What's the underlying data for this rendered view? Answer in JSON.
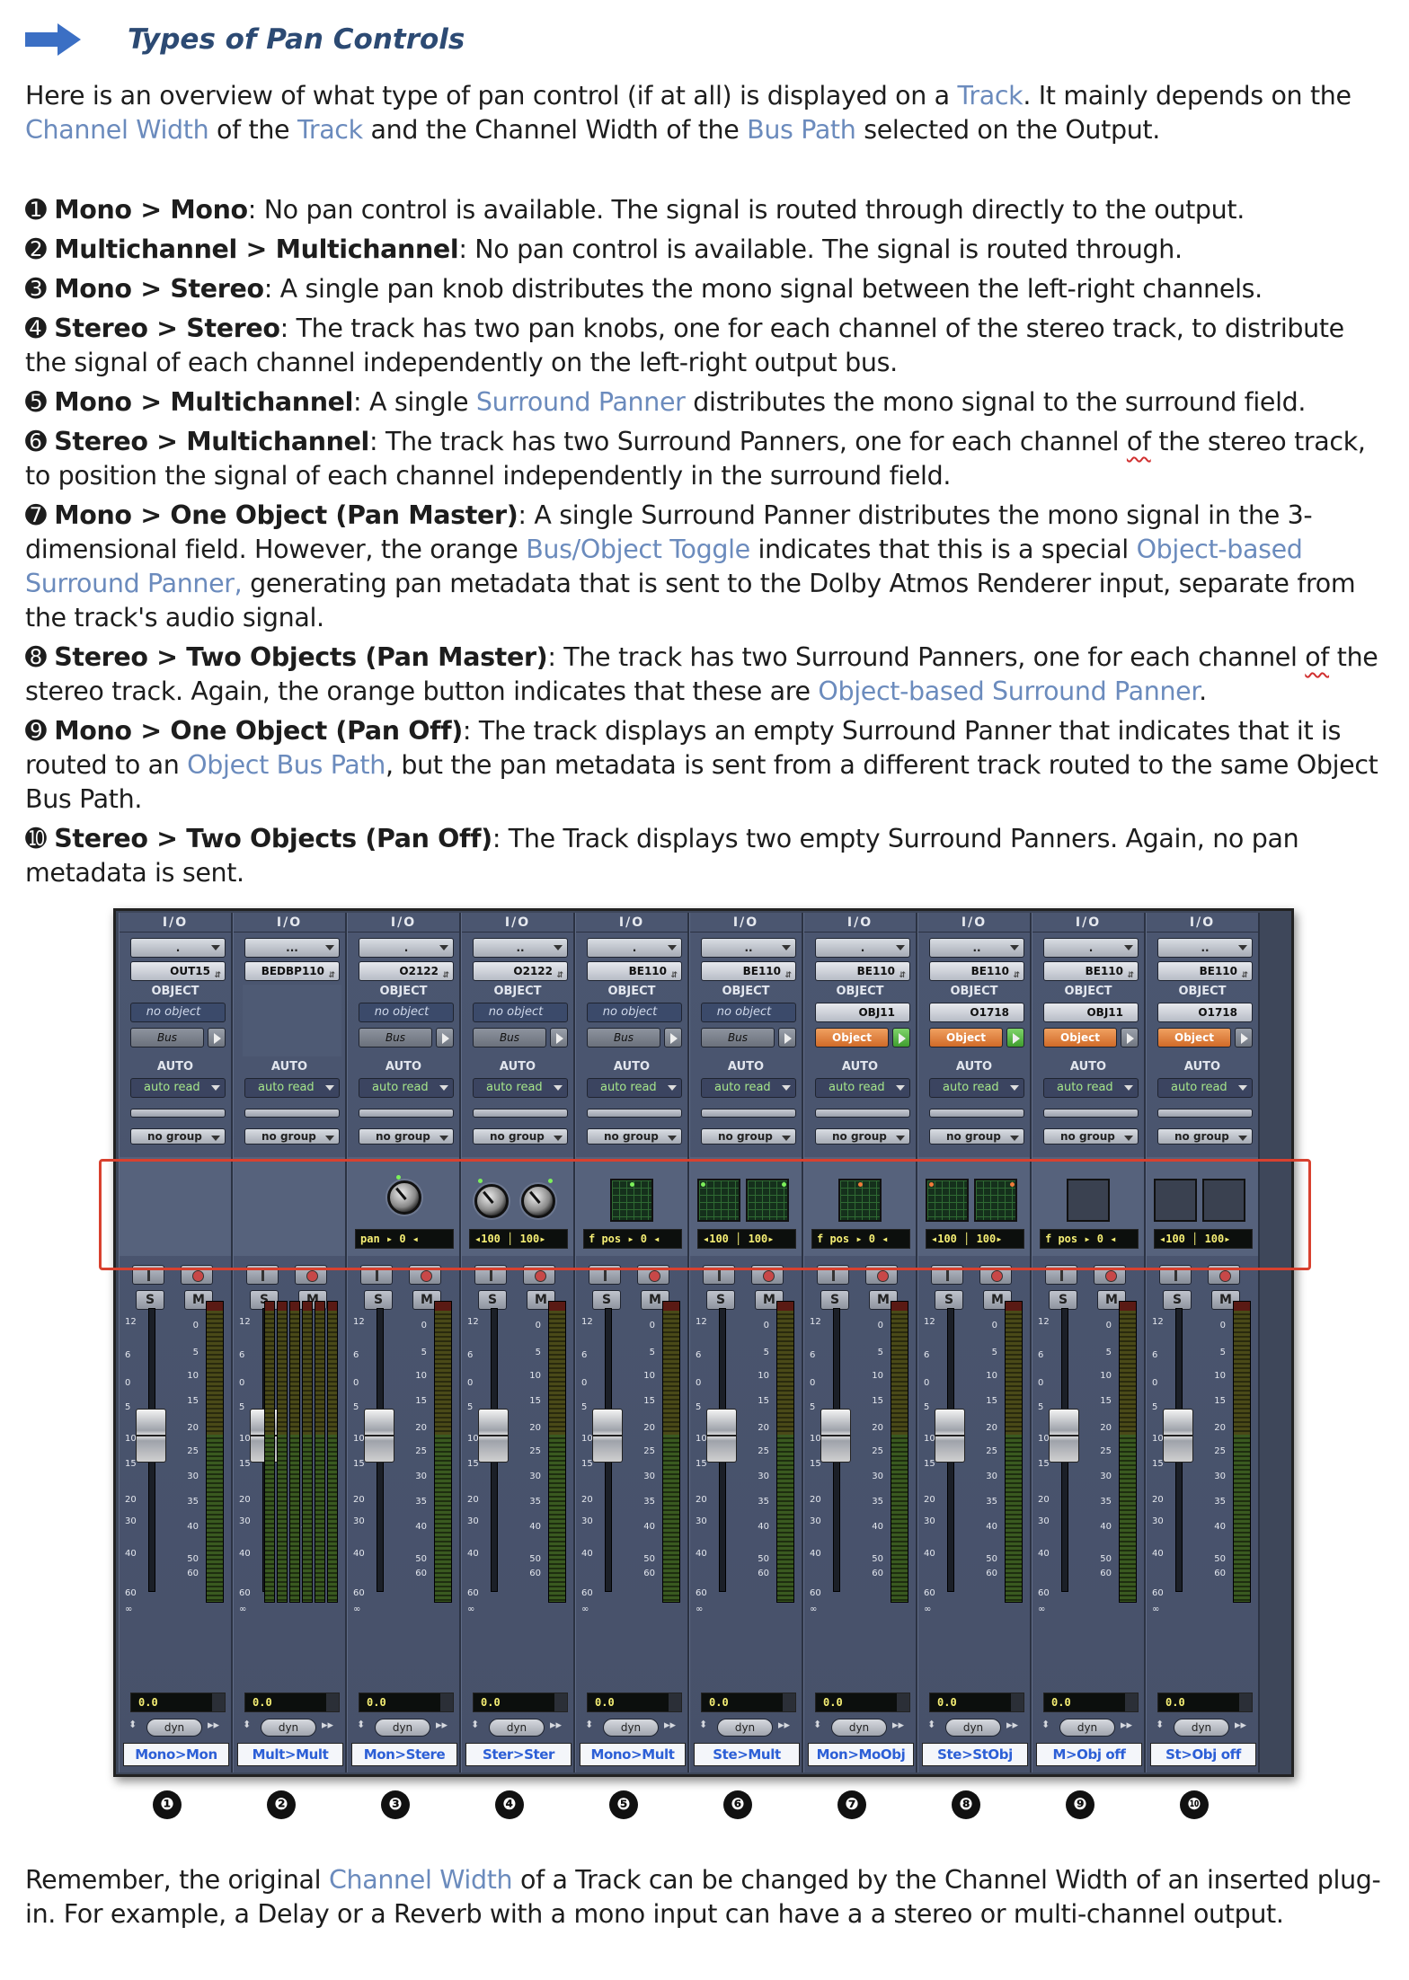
{
  "heading": "Types of Pan Controls",
  "intro": {
    "t1": "Here is an overview of what type of pan control (if at all) is displayed on a ",
    "l1": "Track",
    "t2": ". It mainly depends on the ",
    "l2": "Channel Width",
    "t3": " of the ",
    "l3": "Track",
    "t4": " and the Channel Width of the ",
    "l4": "Bus Path",
    "t5": " selected on the Output."
  },
  "items": [
    {
      "n": "➊",
      "b": "Mono > Mono",
      "t": ": No pan control is available. The signal is routed through directly to the output."
    },
    {
      "n": "➋",
      "b": "Multichannel > Multichannel",
      "t": ": No pan control is available. The signal is routed through."
    },
    {
      "n": "➌",
      "b": "Mono > Stereo",
      "t": ": A single pan knob distributes the mono signal between the left-right channels."
    },
    {
      "n": "➍",
      "b": "Stereo > Stereo",
      "t": ": The track has two pan knobs, one for each channel of the stereo track, to distribute the signal of each channel independently on the left-right output bus."
    },
    {
      "n": "➎",
      "b": "Mono > Multichannel",
      "t": ": A single ",
      "l": "Surround Panner",
      "t2": " distributes the mono signal to the surround field."
    },
    {
      "n": "➏",
      "b": "Stereo > Multichannel",
      "t": ": The track has two Surround Panners, one for each channel ",
      "s": "of",
      "t2": " the stereo track, to position the signal of each channel independently in the surround field."
    },
    {
      "n": "➐",
      "b": "Mono > One Object (Pan Master)",
      "t": ": A single Surround Panner distributes the mono signal in the 3-dimensional field. However, the orange ",
      "l": "Bus/Object Toggle",
      "t2": " indicates that this is a special ",
      "l2": "Object-based Surround Panner,",
      "t3": " generating pan metadata that is sent to the Dolby Atmos Renderer input, separate from the track's audio signal."
    },
    {
      "n": "➑",
      "b": "Stereo > Two Objects (Pan Master)",
      "t": ": The track has two Surround Panners, one for each channel ",
      "s": "of",
      "t2": " the stereo track. Again, the orange button indicates that these are ",
      "l": "Object-based Surround Panner",
      "t3": "."
    },
    {
      "n": "➒",
      "b": "Mono > One Object (Pan Off)",
      "t": ": The track displays an empty Surround Panner that indicates that it is routed to an ",
      "l": "Object Bus Path",
      "t2": ", but the pan metadata is sent from a different track routed to the same Object Bus Path."
    },
    {
      "n": "➓",
      "b": "Stereo > Two Objects (Pan Off)",
      "t": ": The Track displays two empty Surround Panners. Again, no pan metadata is sent."
    }
  ],
  "mixer": {
    "io_label": "I/O",
    "object_label": "OBJECT",
    "auto_label": "AUTO",
    "auto_value": "auto read",
    "group_value": "no group",
    "volume": "0.0",
    "dyn": "dyn",
    "solo": "S",
    "mute": "M",
    "fader_scale": [
      "12",
      "6",
      "0",
      "5",
      "10",
      "15",
      "20",
      "30",
      "40",
      "60",
      "∞"
    ],
    "meter_scale": [
      "0",
      "5",
      "10",
      "15",
      "20",
      "25",
      "30",
      "35",
      "40",
      "50",
      "60"
    ],
    "strips": [
      {
        "input": ".",
        "output": "OUT15",
        "object": "no object",
        "bus": "Bus",
        "obj_mode": false,
        "pan": "none",
        "readout": "",
        "name": "Mono>Mon",
        "number": "❶"
      },
      {
        "input": "...",
        "output": "BEDBP110",
        "object": "",
        "bus": "",
        "obj_mode": false,
        "pan": "none",
        "readout": "",
        "name": "Mult>Mult",
        "number": "❷"
      },
      {
        "input": ".",
        "output": "O2122",
        "object": "no object",
        "bus": "Bus",
        "obj_mode": false,
        "pan": "knob1",
        "readout": "pan  ▸ 0 ◂",
        "name": "Mon>Stere",
        "number": "❸"
      },
      {
        "input": "..",
        "output": "O2122",
        "object": "no object",
        "bus": "Bus",
        "obj_mode": false,
        "pan": "knob2",
        "readout": "◂100 │ 100▸",
        "name": "Ster>Ster",
        "number": "❹"
      },
      {
        "input": ".",
        "output": "BE110",
        "object": "no object",
        "bus": "Bus",
        "obj_mode": false,
        "pan": "grid1",
        "readout": "f pos ▸ 0 ◂",
        "name": "Mono>Mult",
        "number": "❺"
      },
      {
        "input": "..",
        "output": "BE110",
        "object": "no object",
        "bus": "Bus",
        "obj_mode": false,
        "pan": "grid2",
        "readout": "◂100 │ 100▸",
        "name": "Ste>Mult",
        "number": "❻"
      },
      {
        "input": ".",
        "output": "BE110",
        "object": "OBJ11",
        "bus": "Object",
        "obj_mode": true,
        "play_on": true,
        "pan": "grid1o",
        "readout": "f pos ▸ 0 ◂",
        "name": "Mon>MoObj",
        "number": "❼"
      },
      {
        "input": "..",
        "output": "BE110",
        "object": "O1718",
        "bus": "Object",
        "obj_mode": true,
        "play_on": true,
        "pan": "grid2o",
        "readout": "◂100 │ 100▸",
        "name": "Ste>StObj",
        "number": "❽"
      },
      {
        "input": ".",
        "output": "BE110",
        "object": "OBJ11",
        "bus": "Object",
        "obj_mode": true,
        "play_on": false,
        "pan": "empty1",
        "readout": "f pos ▸ 0 ◂",
        "name": "M>Obj off",
        "number": "❾"
      },
      {
        "input": "..",
        "output": "BE110",
        "object": "O1718",
        "bus": "Object",
        "obj_mode": true,
        "play_on": false,
        "pan": "empty2",
        "readout": "◂100 │ 100▸",
        "name": "St>Obj off",
        "number": "❿"
      }
    ]
  },
  "outro": {
    "t1": "Remember, the original ",
    "l1": "Channel Width",
    "t2": " of a Track can be changed by the Channel Width of an inserted plug-in. For example, a Delay or a Reverb with a mono input can have a a stereo or multi-channel output."
  },
  "colors": {
    "accent": "#2c4a73",
    "link": "#6b8bbd",
    "highlight": "#d8412f",
    "object_orange": "#e07a34"
  }
}
